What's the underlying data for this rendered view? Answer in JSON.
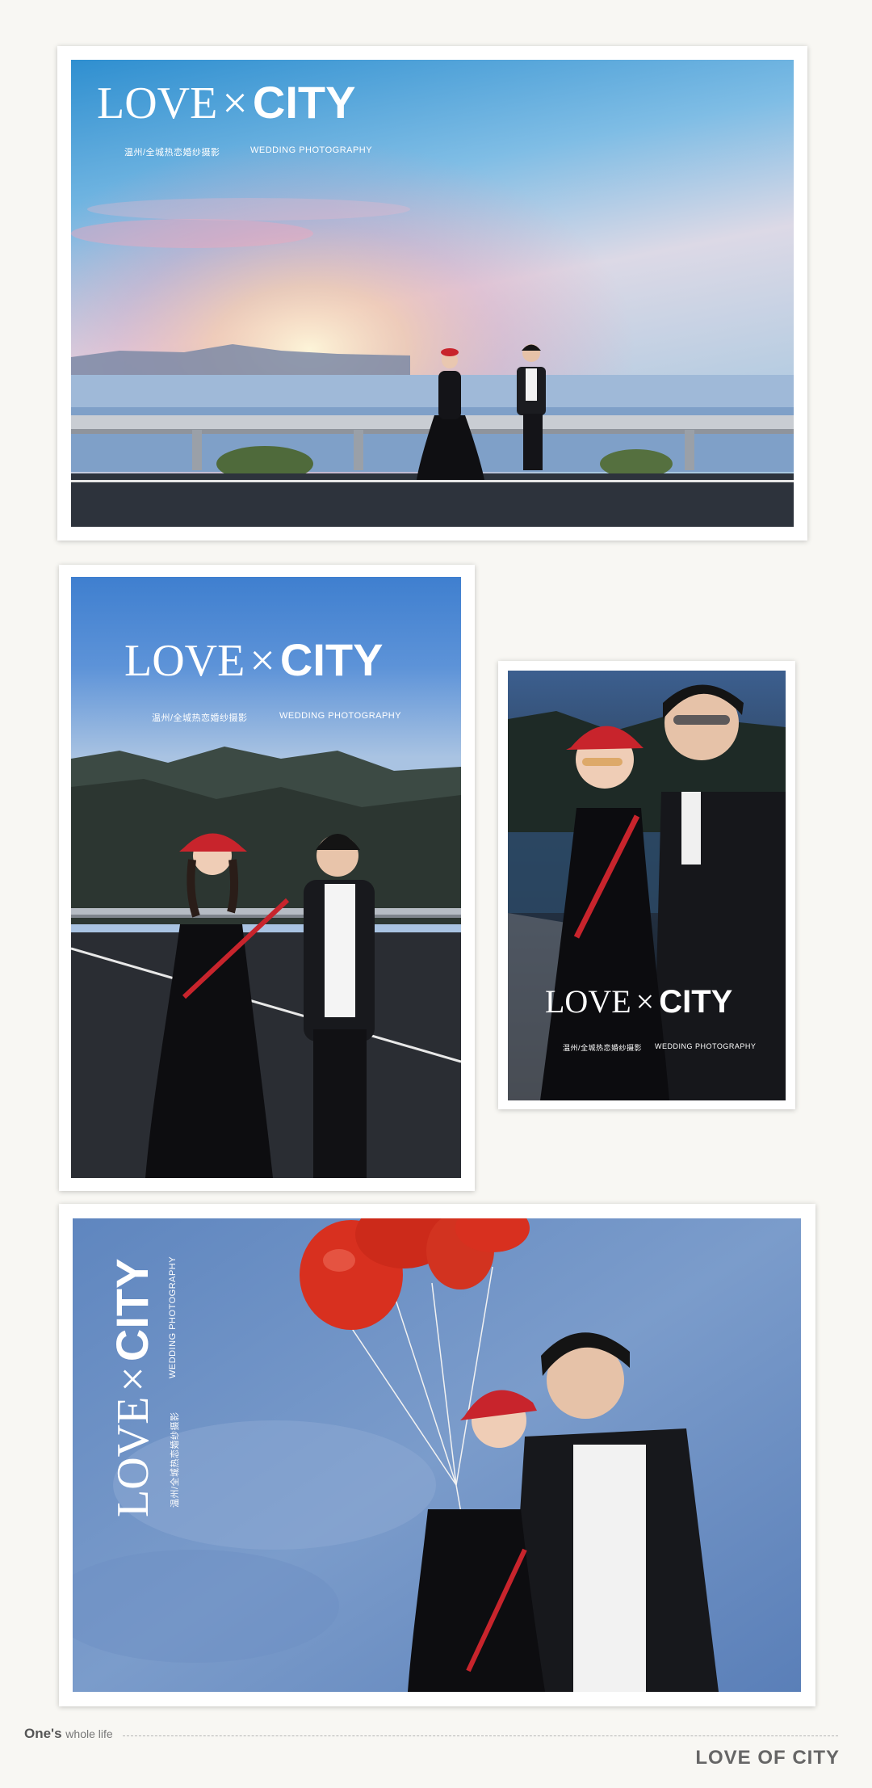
{
  "brand": {
    "love": "LOVE",
    "cross": "×",
    "city": "CITY"
  },
  "subtitle_cn": "温州/全城热恋婚纱摄影",
  "subtitle_en": "WEDDING PHOTOGRAPHY",
  "photos": [
    {
      "scene": "couple sitting on a seaside road guardrail at sunset"
    },
    {
      "scene": "couple walking on a mountain road at dusk, woman in red cap"
    },
    {
      "scene": "close-up of couple in sunglasses and leather jacket by the road"
    },
    {
      "scene": "couple under a bunch of red balloons against blue sky"
    }
  ],
  "footer": {
    "tagline_bold": "One's",
    "tagline_rest": "whole life",
    "title": "LOVE OF CITY"
  },
  "colors": {
    "page_background": "#f8f7f3",
    "balloon_red": "#d8301f",
    "cap_red": "#c8242c",
    "text_gray": "#666666"
  }
}
